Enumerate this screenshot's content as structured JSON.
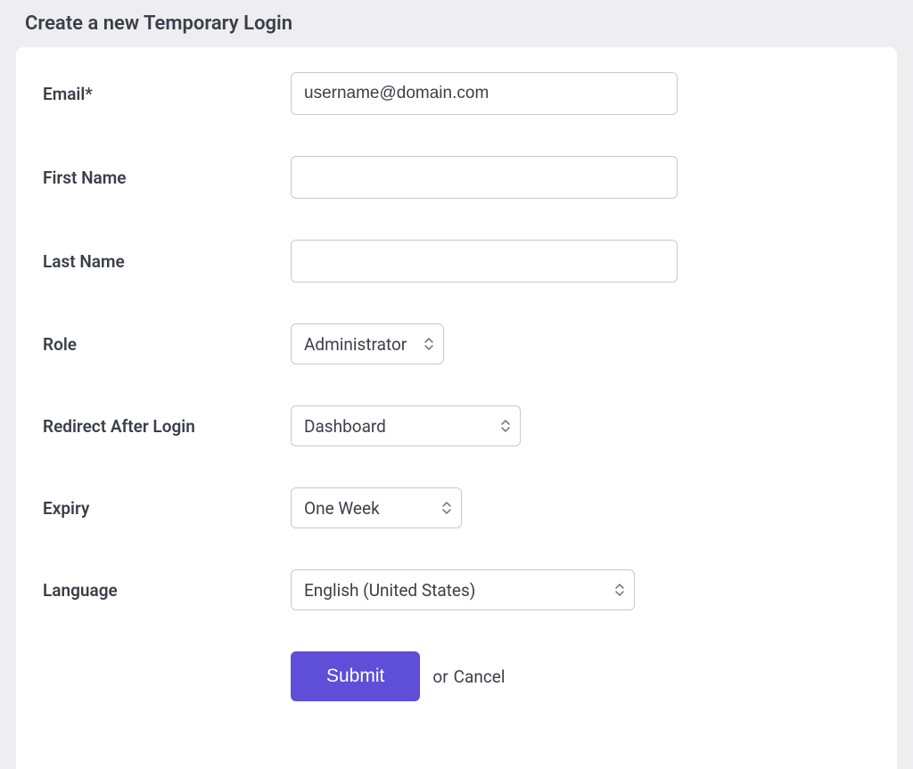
{
  "title": "Create a new Temporary Login",
  "form": {
    "email": {
      "label": "Email*",
      "value": "username@domain.com",
      "placeholder": ""
    },
    "first_name": {
      "label": "First Name",
      "value": "",
      "placeholder": ""
    },
    "last_name": {
      "label": "Last Name",
      "value": "",
      "placeholder": ""
    },
    "role": {
      "label": "Role",
      "selected": "Administrator"
    },
    "redirect": {
      "label": "Redirect After Login",
      "selected": "Dashboard"
    },
    "expiry": {
      "label": "Expiry",
      "selected": "One Week"
    },
    "language": {
      "label": "Language",
      "selected": "English (United States)"
    }
  },
  "actions": {
    "submit_label": "Submit",
    "or_text": "or",
    "cancel_label": "Cancel"
  }
}
